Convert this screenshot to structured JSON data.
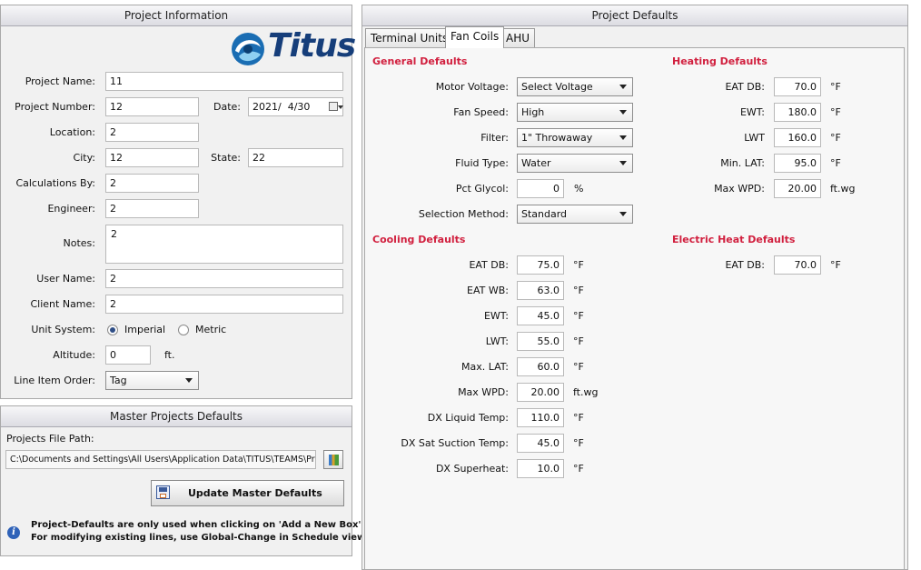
{
  "project_info": {
    "header": "Project Information",
    "logo_text": "Titus",
    "fields": {
      "project_name": {
        "label": "Project Name:",
        "value": "11"
      },
      "project_number": {
        "label": "Project Number:",
        "value": "12"
      },
      "date": {
        "label": "Date:",
        "value": "2021/  4/30"
      },
      "location": {
        "label": "Location:",
        "value": "2"
      },
      "city": {
        "label": "City:",
        "value": "12"
      },
      "state": {
        "label": "State:",
        "value": "22"
      },
      "calculations_by": {
        "label": "Calculations By:",
        "value": "2"
      },
      "engineer": {
        "label": "Engineer:",
        "value": "2"
      },
      "notes": {
        "label": "Notes:",
        "value": "2"
      },
      "user_name": {
        "label": "User Name:",
        "value": "2"
      },
      "client_name": {
        "label": "Client Name:",
        "value": "2"
      },
      "unit_system": {
        "label": "Unit System:",
        "options": [
          "Imperial",
          "Metric"
        ],
        "selected": "Imperial"
      },
      "altitude": {
        "label": "Altitude:",
        "value": "0",
        "unit": "ft."
      },
      "line_item_order": {
        "label": "Line Item Order:",
        "value": "Tag"
      }
    }
  },
  "master_defaults": {
    "header": "Master Projects Defaults",
    "file_path_label": "Projects File Path:",
    "file_path_value": "C:\\Documents and Settings\\All Users\\Application Data\\TITUS\\TEAMS\\Pro",
    "update_button": "Update Master Defaults",
    "info_line1": "Project-Defaults are only used when clicking on 'Add a New Box'.",
    "info_line2": "For modifying existing lines, use Global-Change in Schedule view."
  },
  "project_defaults": {
    "header": "Project Defaults",
    "tabs": [
      {
        "label": "Terminal Units",
        "active": false
      },
      {
        "label": "Fan Coils",
        "active": true
      },
      {
        "label": "AHU",
        "active": false
      }
    ],
    "general": {
      "title": "General Defaults",
      "motor_voltage": {
        "label": "Motor Voltage:",
        "value": "Select Voltage"
      },
      "fan_speed": {
        "label": "Fan Speed:",
        "value": "High"
      },
      "filter": {
        "label": "Filter:",
        "value": "1\" Throwaway"
      },
      "fluid_type": {
        "label": "Fluid Type:",
        "value": "Water"
      },
      "pct_glycol": {
        "label": "Pct Glycol:",
        "value": "0",
        "unit": "%"
      },
      "selection_method": {
        "label": "Selection Method:",
        "value": "Standard"
      }
    },
    "cooling": {
      "title": "Cooling Defaults",
      "rows": [
        {
          "label": "EAT DB:",
          "value": "75.0",
          "unit": "°F"
        },
        {
          "label": "EAT WB:",
          "value": "63.0",
          "unit": "°F"
        },
        {
          "label": "EWT:",
          "value": "45.0",
          "unit": "°F"
        },
        {
          "label": "LWT:",
          "value": "55.0",
          "unit": "°F"
        },
        {
          "label": "Max. LAT:",
          "value": "60.0",
          "unit": "°F"
        },
        {
          "label": "Max WPD:",
          "value": "20.00",
          "unit": "ft.wg"
        },
        {
          "label": "DX Liquid Temp:",
          "value": "110.0",
          "unit": "°F"
        },
        {
          "label": "DX Sat Suction Temp:",
          "value": "45.0",
          "unit": "°F"
        },
        {
          "label": "DX Superheat:",
          "value": "10.0",
          "unit": "°F"
        }
      ]
    },
    "heating": {
      "title": "Heating Defaults",
      "rows": [
        {
          "label": "EAT DB:",
          "value": "70.0",
          "unit": "°F"
        },
        {
          "label": "EWT:",
          "value": "180.0",
          "unit": "°F"
        },
        {
          "label": "LWT",
          "value": "160.0",
          "unit": "°F"
        },
        {
          "label": "Min. LAT:",
          "value": "95.0",
          "unit": "°F"
        },
        {
          "label": "Max WPD:",
          "value": "20.00",
          "unit": "ft.wg"
        }
      ]
    },
    "electric_heat": {
      "title": "Electric Heat Defaults",
      "rows": [
        {
          "label": "EAT DB:",
          "value": "70.0",
          "unit": "°F"
        }
      ]
    }
  }
}
